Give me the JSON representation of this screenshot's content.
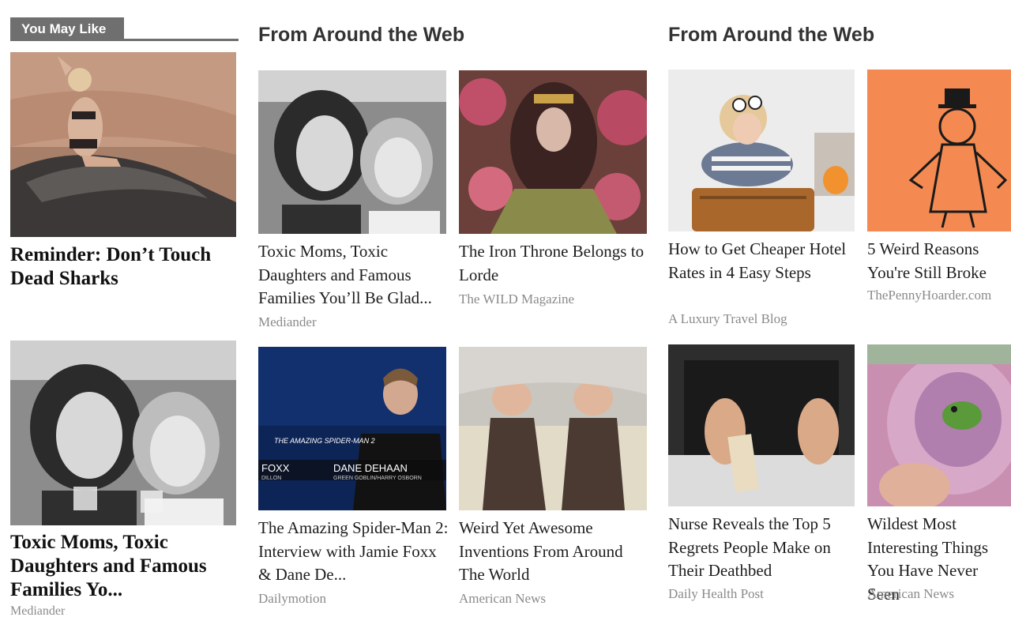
{
  "you_may_like": {
    "tab_label": "You May Like",
    "items": [
      {
        "title": "Reminder: Don’t Touch Dead Sharks",
        "source": "",
        "image_icon": "woman-on-shark-photo"
      },
      {
        "title": "Toxic Moms, Toxic Daughters and Famous Families Yo...",
        "source": "Mediander",
        "image_icon": "vintage-mother-daughter-photo"
      }
    ]
  },
  "around_web_1": {
    "heading": "From Around the Web",
    "items": [
      {
        "title": "Toxic Moms, Toxic Daughters and Famous Families You’ll Be Glad...",
        "source": "Mediander"
      },
      {
        "title": "The Iron Throne Belongs to Lorde",
        "source": "The WILD Magazine"
      },
      {
        "title": "The Amazing Spider-Man 2: Interview with Jamie Foxx & Dane De...",
        "source": "Dailymotion",
        "overlay_logo": "THE AMAZING SPIDER-MAN 2",
        "overlay_left": "FOXX",
        "overlay_left_sub": "DILLON",
        "overlay_right": "DANE DEHAAN",
        "overlay_right_sub": "GREEN GOBLIN/HARRY OSBORN"
      },
      {
        "title": "Weird Yet Awesome Inventions From Around The World",
        "source": "American News"
      }
    ]
  },
  "around_web_2": {
    "heading": "From Around the Web",
    "items": [
      {
        "title": "How to Get Cheaper Hotel Rates in 4 Easy Steps",
        "source": "A Luxury Travel Blog"
      },
      {
        "title": "5 Weird Reasons You're Still Broke",
        "source": "ThePennyHoarder.com"
      },
      {
        "title": "Nurse Reveals the Top 5 Regrets People Make on Their Deathbed",
        "source": "Daily Health Post"
      },
      {
        "title": "Wildest Most Interesting Things You Have Never Seen",
        "source": "American News"
      }
    ]
  },
  "colors": {
    "tab_bg": "#6f6f6f",
    "heading_text": "#333333",
    "title_text": "#1e1e1e",
    "source_text": "#8a8a8a"
  }
}
